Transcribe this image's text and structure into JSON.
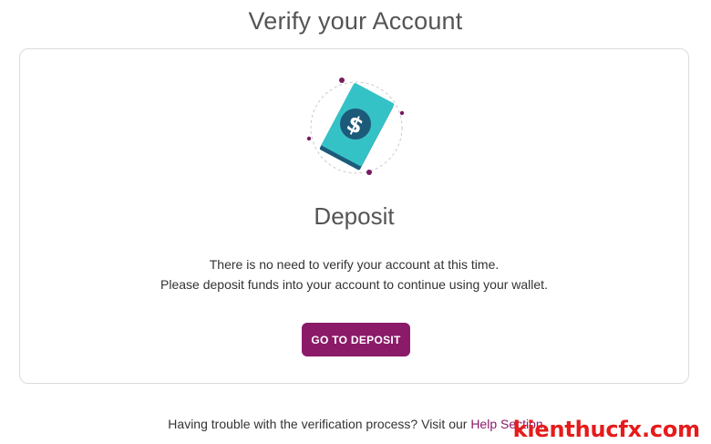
{
  "page": {
    "title": "Verify your Account"
  },
  "card": {
    "illustration_icon": "money-bill-dollar-icon",
    "heading": "Deposit",
    "line1": "There is no need to verify your account at this time.",
    "line2": "Please deposit funds into your account to continue using your wallet.",
    "button_label": "GO TO DEPOSIT"
  },
  "footer": {
    "text": "Having trouble with the verification process? Visit our ",
    "link_label": "Help Section"
  },
  "watermark": "kienthucfx.com",
  "colors": {
    "accent": "#8b1a68",
    "bill_teal": "#35c2c7",
    "bill_navy": "#1c5a7a",
    "watermark_red": "#e61b1b"
  }
}
